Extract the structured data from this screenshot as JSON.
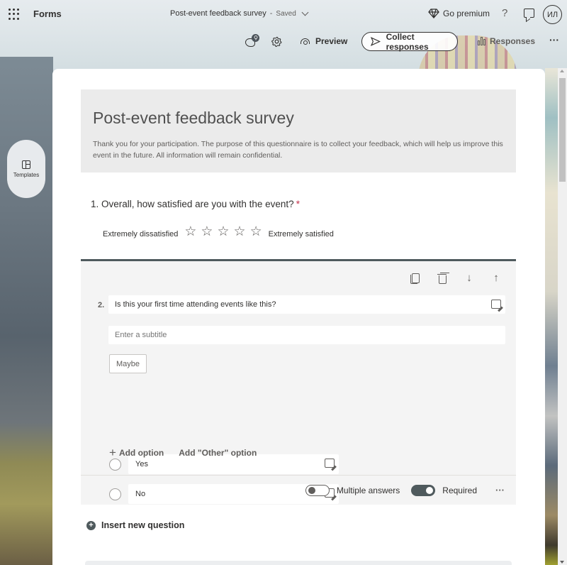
{
  "topbar": {
    "app_name": "Forms",
    "doc_title": "Post-event feedback survey",
    "separator": "-",
    "save_status": "Saved",
    "premium_label": "Go premium",
    "help_glyph": "?",
    "avatar_initials": "ИЛ",
    "icons": [
      "waffle-icon",
      "chevron-down-icon",
      "diamond-icon",
      "help-icon",
      "feedback-icon"
    ]
  },
  "actionbar": {
    "theme_badge": "",
    "preview_label": "Preview",
    "collect_label": "Collect responses",
    "responses_label": "Responses",
    "more_glyph": "···",
    "icons": [
      "palette-icon",
      "gear-icon",
      "eye-icon",
      "send-icon",
      "bar-chart-icon",
      "more-icon"
    ]
  },
  "sidebar": {
    "templates_label": "Templates"
  },
  "form": {
    "title": "Post-event feedback survey",
    "description": "Thank you for your participation. The purpose of this questionnaire is to collect your feedback, which will help us improve this event in the future. All information will remain confidential."
  },
  "question1": {
    "number": "1.",
    "text": "Overall, how satisfied are you with the event?",
    "required_mark": "*",
    "low_label": "Extremely dissatisfied",
    "high_label": "Extremely satisfied",
    "star_count": 5,
    "rating_value": 0,
    "star_glyph": "☆"
  },
  "question2": {
    "number": "2.",
    "text": "Is this your first time attending events like this?",
    "subtitle_placeholder": "Enter a subtitle",
    "suggestion_chip": "Maybe",
    "options": [
      {
        "label": "Yes"
      },
      {
        "label": "No"
      }
    ],
    "add_option_label": "Add option",
    "add_other_label": "Add \"Other\" option",
    "multiple_answers_label": "Multiple answers",
    "multiple_answers_on": false,
    "required_label": "Required",
    "required_on": true,
    "more_glyph": "···",
    "tools": [
      "copy-icon",
      "delete-icon",
      "move-down-icon",
      "move-up-icon"
    ]
  },
  "insert_question_label": "Insert new question",
  "colors": {
    "accent": "#4f5a5d",
    "required_star": "#c4314b",
    "header_box": "#ebebeb",
    "question_bg": "#f4f4f4"
  }
}
